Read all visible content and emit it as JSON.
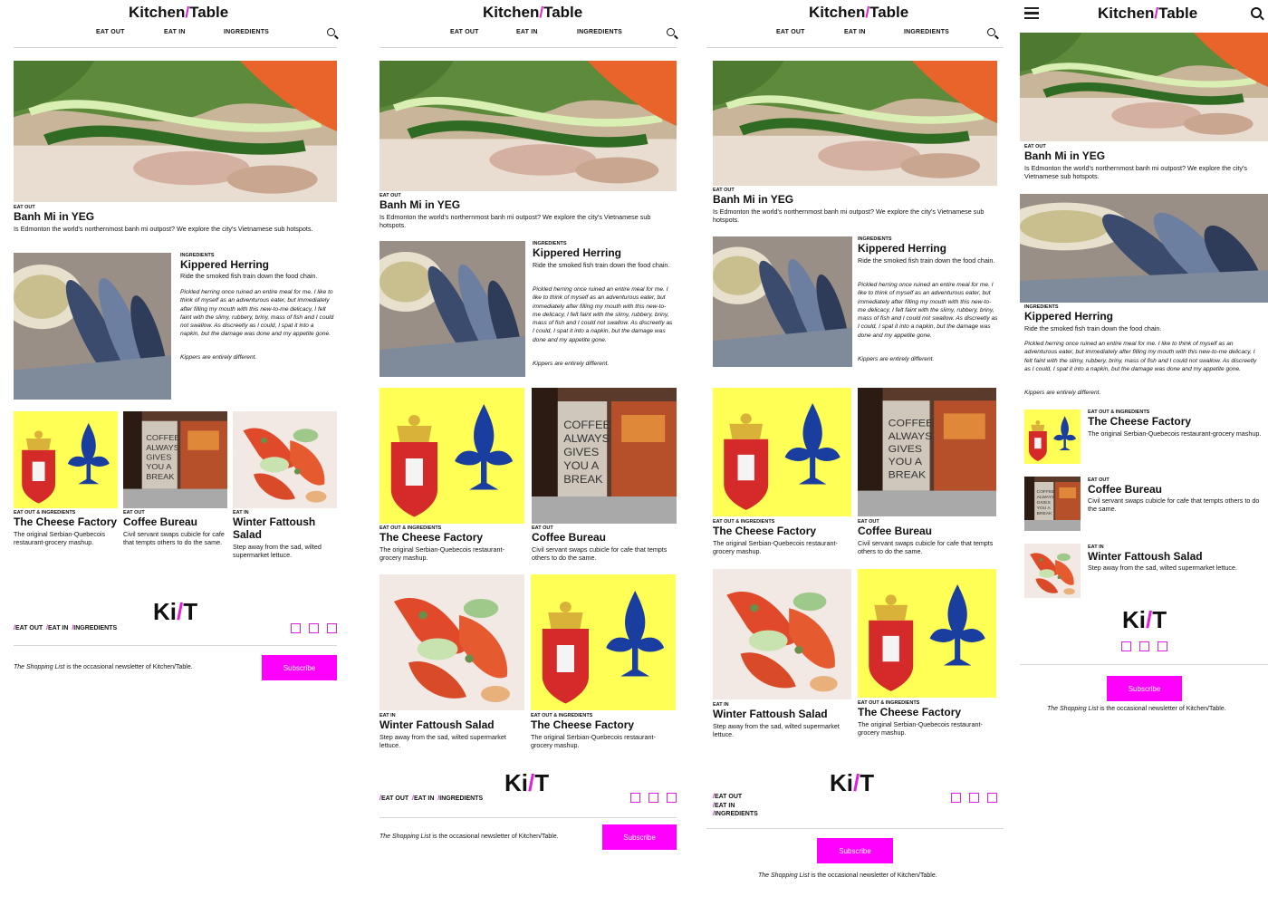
{
  "brand": {
    "name_a": "Kitchen",
    "slash": "/",
    "name_b": "Table",
    "short_a": "Ki",
    "short_b": "T"
  },
  "nav": {
    "eat_out": "EAT OUT",
    "eat_in": "EAT IN",
    "ingredients": "INGREDIENTS"
  },
  "articles": {
    "banh": {
      "kicker": "EAT OUT",
      "title": "Banh Mi in YEG",
      "desc": "Is Edmonton the world's northernmost banh mi outpost? We explore the city's Vietnamese sub hotspots."
    },
    "herring": {
      "kicker": "INGREDIENTS",
      "title": "Kippered Herring",
      "desc": "Ride the smoked fish train down the food chain.",
      "body": "Pickled herring once ruined an entire meal for me. I like to think of myself as an adventurous eater, but immediately after filling my mouth with this new-to-me delicacy, I felt faint with the slimy, rubbery, briny, mass of fish and I could not swallow. As discreetly as I could, I spat it into a napkin, but the damage was done and my appetite gone.",
      "body2": "Kippers are entirely different."
    },
    "cheese": {
      "kicker": "EAT OUT & INGREDIENTS",
      "title": "The Cheese Factory",
      "desc": "The original Serbian-Quebecois restaurant-grocery mashup."
    },
    "coffee": {
      "kicker": "EAT OUT",
      "title": "Coffee Bureau",
      "desc": "Civil servant swaps cubicle for cafe that tempts others to do the same."
    },
    "salad": {
      "kicker": "EAT IN",
      "title": "Winter Fattoush Salad",
      "desc": "Step away from the sad, wilted supermarket lettuce."
    }
  },
  "footer": {
    "link_eat_out": "EAT OUT",
    "link_eat_in": "EAT IN",
    "link_ingredients": "INGREDIENTS",
    "newsletter_name": "The Shopping List",
    "newsletter_rest": " is the occasional newsletter of Kitchen/Table.",
    "subscribe": "Subscribe"
  },
  "colors": {
    "accent": "#ff00ff",
    "flag_yellow": "#ffff55",
    "fleur_blue": "#1a3ea0"
  },
  "icons": [
    "search-icon",
    "hamburger-icon",
    "social-icon"
  ]
}
